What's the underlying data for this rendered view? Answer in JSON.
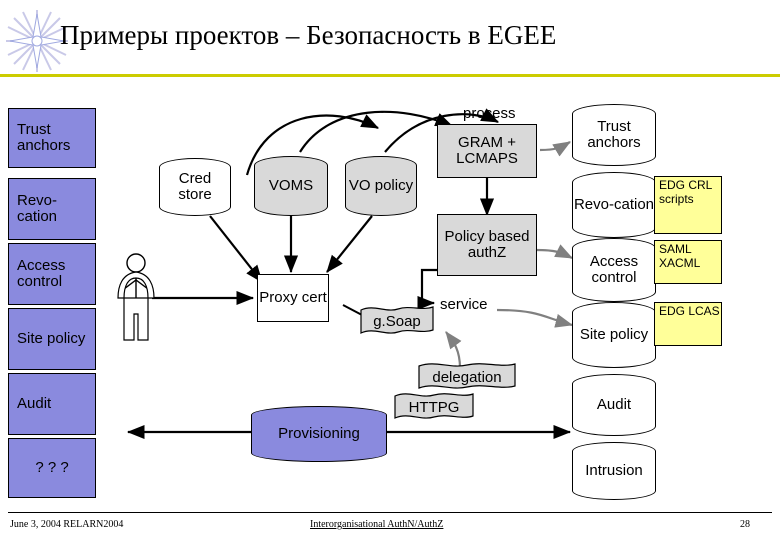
{
  "slide": {
    "title": "Примеры проектов – Безопасность в EGEE",
    "footer": {
      "left": "June 3, 2004 RELARN2004",
      "center": "Interorganisational AuthN/AuthZ",
      "right": "28"
    },
    "accent_color": "#cccc00",
    "stack_color": "#8a8ade",
    "grey_color": "#d9d9d9",
    "yellow_color": "#ffff99"
  },
  "left_stack": {
    "items": [
      {
        "label": "Trust anchors"
      },
      {
        "label": "Revo-cation"
      },
      {
        "label": "Access control"
      },
      {
        "label": "Site policy"
      },
      {
        "label": "Audit"
      },
      {
        "label": "? ? ?"
      }
    ]
  },
  "right_stack": {
    "items": [
      {
        "label": "Trust anchors"
      },
      {
        "label": "Revo-cation"
      },
      {
        "label": "Access control"
      },
      {
        "label": "Site policy"
      },
      {
        "label": "Audit"
      },
      {
        "label": "Intrusion"
      }
    ]
  },
  "yellow_notes": [
    {
      "label": "EDG CRL scripts"
    },
    {
      "label": "SAML XACML"
    },
    {
      "label": "EDG LCAS"
    }
  ],
  "middle": {
    "cred_store": "Cred store",
    "voms": "VOMS",
    "vo_policy": "VO policy",
    "proxy_cert": "Proxy cert",
    "provisioning": "Provisioning",
    "user_icon": "person-icon"
  },
  "right_flow": {
    "process": "process",
    "gram_lcmaps": "GRAM + LCMAPS",
    "policy_authz": "Policy based authZ",
    "gsoap": "g.Soap",
    "service": "service",
    "delegation": "delegation",
    "httpg": "HTTPG"
  }
}
